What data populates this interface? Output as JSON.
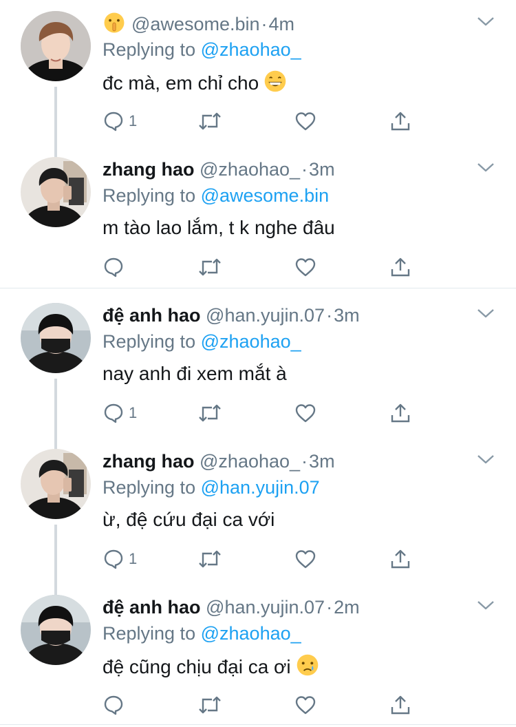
{
  "tweets": [
    {
      "display_name": "",
      "name_emoji": "shushing-face-emoji",
      "handle": "@awesome.bin",
      "time": "4m",
      "replying_prefix": "Replying to",
      "replying_to": "@zhaohao_",
      "text": "đc mà, em chỉ cho",
      "text_emoji": "grinning-face-emoji",
      "reply_count": "1"
    },
    {
      "display_name": "zhang hao",
      "handle": "@zhaohao_",
      "time": "3m",
      "replying_prefix": "Replying to",
      "replying_to": "@awesome.bin",
      "text": "m tào lao lắm, t k nghe đâu",
      "reply_count": ""
    },
    {
      "display_name": "đệ anh hao",
      "handle": "@han.yujin.07",
      "time": "3m",
      "replying_prefix": "Replying to",
      "replying_to": "@zhaohao_",
      "text": "nay anh đi xem mắt à",
      "reply_count": "1"
    },
    {
      "display_name": "zhang hao",
      "handle": "@zhaohao_",
      "time": "3m",
      "replying_prefix": "Replying to",
      "replying_to": "@han.yujin.07",
      "text": "ừ, đệ cứu đại ca với",
      "reply_count": "1"
    },
    {
      "display_name": "đệ anh hao",
      "handle": "@han.yujin.07",
      "time": "2m",
      "replying_prefix": "Replying to",
      "replying_to": "@zhaohao_",
      "text": "đệ cũng chịu đại ca ơi",
      "text_emoji": "crying-face-emoji",
      "reply_count": ""
    }
  ],
  "dot": "·",
  "colors": {
    "link": "#1da1f2",
    "secondary_text": "#657786",
    "thread_line": "#d3d9de",
    "divider": "#e1e8ed"
  },
  "icons": [
    "reply-icon",
    "retweet-icon",
    "like-icon",
    "share-icon",
    "chevron-down-icon"
  ]
}
